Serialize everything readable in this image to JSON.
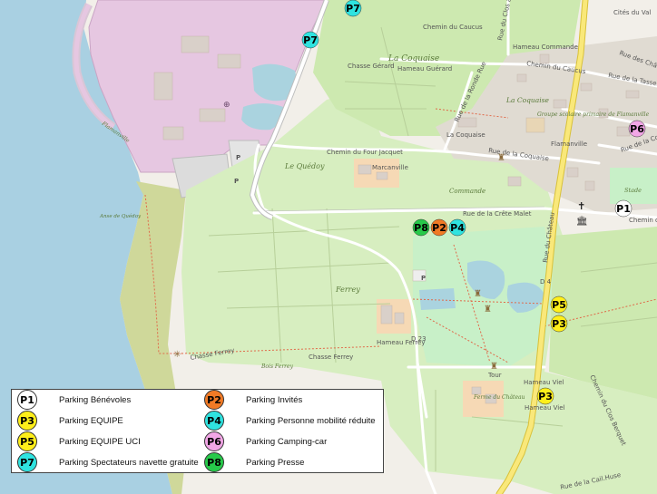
{
  "colors": {
    "sea": "#a9d0e2",
    "land": "#f2efe9",
    "industrial": "#e6c7e1",
    "meadow": "#d7eec0",
    "grass": "#cde9b0",
    "farmyard": "#f6d9b5",
    "park": "#c8f0c8",
    "coast": "#cfd89a",
    "road_main": "#f9e87a",
    "road_outline": "#d8c13a",
    "water": "#aad3df",
    "parking_colors": {
      "P1": "#ffffff",
      "P2": "#f07a26",
      "P3": "#ffef1a",
      "P4": "#2fe3e0",
      "P5": "#ffef1a",
      "P6": "#f2a6e6",
      "P7": "#2fe3e0",
      "P8": "#27c94a"
    }
  },
  "map_labels": {
    "cites_du_val": "Cités du Val",
    "chemin_du_caucus": "Chemin du Caucus",
    "rue_du_clos": "Rue du Clos au Val",
    "hameau_commande": "Hameau Commande",
    "chemin_du_caucus_2": "Chemin du Caucus",
    "rue_chataigniers": "Rue des Châtaigniers",
    "la_coquaise": "La Coquaise",
    "hameau_guerard": "Hameau Guérard",
    "chasse_gerard": "Chasse Gérard",
    "rue_tasserie": "Rue de la Tasserie",
    "la_coquaise_2": "La Coquaise",
    "rue_ronde_rue": "Rue de la Ronde Rue",
    "flamanville_coast": "Flamanville",
    "groupe_scolaire": "Groupe scolaire primaire de Flamanville",
    "la_coquaise_3": "La Coquaise",
    "flamanville": "Flamanville",
    "rue_compagnie": "Rue de la Compagnie",
    "chemin_four_jacquet": "Chemin du Four Jacquet",
    "rue_coquaise": "Rue de la Coquaise",
    "le_quedoy": "Le Quédoy",
    "marcanville": "Marcanville",
    "commande": "Commande",
    "stade": "Stade",
    "rue_crete_malet": "Rue de la Crête Malet",
    "chemin_de_la": "Chemin de la",
    "anse": "Anse de Quédoy",
    "d4": "D 4",
    "rue_du_chateau": "Rue du Château",
    "ferrey": "Ferrey",
    "d23": "D 23",
    "hameau_ferrey": "Hameau Ferrey",
    "chasse_ferrey_1": "Chasse Ferrey",
    "chasse_ferrey_2": "Chasse Ferrey",
    "bois_ferrey": "Bois Ferrey",
    "tour": "Tour",
    "hameau_viel": "Hameau Viel",
    "chemin_clos_berquet": "Chemin du Clos Berquet",
    "hameau_viel_2": "Hameau Viel",
    "ferme_chateau": "Ferme du Château",
    "rue_caillouse": "Rue de la Cail.Huse",
    "parking_p": "P"
  },
  "markers": [
    {
      "code": "P7",
      "color": "#2fe3e0"
    },
    {
      "code": "P7",
      "color": "#2fe3e0"
    },
    {
      "code": "P6",
      "color": "#f2a6e6"
    },
    {
      "code": "P1",
      "color": "#ffffff"
    },
    {
      "code": "P8",
      "color": "#27c94a"
    },
    {
      "code": "P2",
      "color": "#f07a26"
    },
    {
      "code": "P4",
      "color": "#2fe3e0"
    },
    {
      "code": "P5",
      "color": "#ffef1a"
    },
    {
      "code": "P3",
      "color": "#ffef1a"
    },
    {
      "code": "P3",
      "color": "#ffef1a"
    }
  ],
  "legend": [
    {
      "code": "P1",
      "label": "Parking Bénévoles",
      "color": "#ffffff"
    },
    {
      "code": "P2",
      "label": "Parking Invités",
      "color": "#f07a26"
    },
    {
      "code": "P3",
      "label": "Parking EQUIPE",
      "color": "#ffef1a"
    },
    {
      "code": "P4",
      "label": "Parking Personne mobilité réduite",
      "color": "#2fe3e0"
    },
    {
      "code": "P5",
      "label": "Parking EQUIPE UCI",
      "color": "#ffef1a"
    },
    {
      "code": "P6",
      "label": "Parking Camping-car",
      "color": "#f2a6e6"
    },
    {
      "code": "P7",
      "label": "Parking Spectateurs navette gratuite",
      "color": "#2fe3e0"
    },
    {
      "code": "P8",
      "label": "Parking Presse",
      "color": "#27c94a"
    }
  ]
}
